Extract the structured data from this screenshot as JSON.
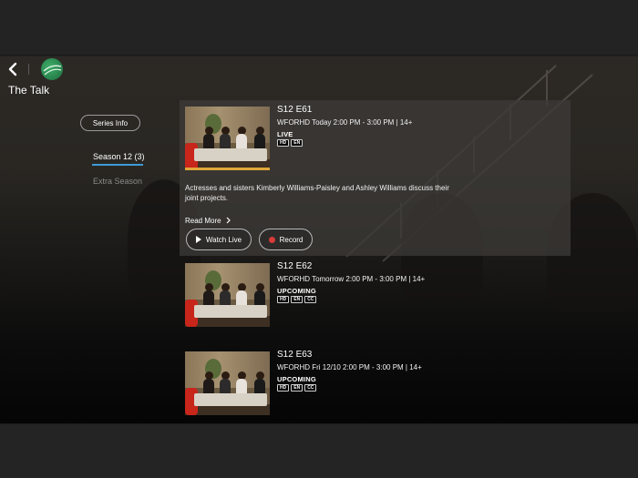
{
  "show": {
    "title": "The Talk"
  },
  "nav": {
    "series_info": "Series Info",
    "season_tab": "Season 12 (3)",
    "extra_tab": "Extra Season"
  },
  "episodes": [
    {
      "title": "S12 E61",
      "meta": "WFORHD Today 2:00 PM - 3:00 PM | 14+",
      "status": "LIVE",
      "badges": [
        "HD",
        "EN"
      ],
      "description": "Actresses and sisters Kimberly Williams-Paisley and Ashley Williams discuss their joint projects.",
      "read_more": "Read More",
      "watch_live": "Watch Live",
      "record": "Record"
    },
    {
      "title": "S12 E62",
      "meta": "WFORHD Tomorrow 2:00 PM - 3:00 PM | 14+",
      "status": "UPCOMING",
      "badges": [
        "HD",
        "EN",
        "CC"
      ]
    },
    {
      "title": "S12 E63",
      "meta": "WFORHD Fri 12/10 2:00 PM - 3:00 PM | 14+",
      "status": "UPCOMING",
      "badges": [
        "HD",
        "EN",
        "CC"
      ]
    }
  ],
  "colors": {
    "accent_underline": "#3e9bd8",
    "record_dot": "#d63a3a",
    "live_progress": "#e0a63a"
  }
}
